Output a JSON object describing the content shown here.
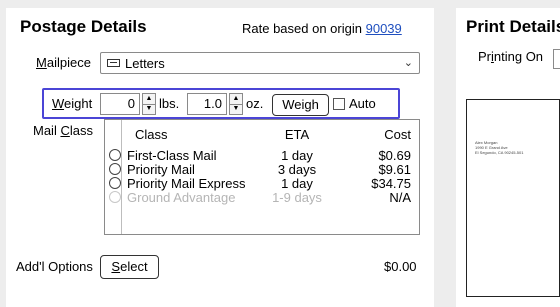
{
  "postage": {
    "title": "Postage Details",
    "rate_text": "Rate based on origin",
    "rate_zip": "90039",
    "mailpiece_label_u": "M",
    "mailpiece_label_rest": "ailpiece",
    "mailpiece_value": "Letters",
    "weight_label_u": "W",
    "weight_label_rest": "eight",
    "lbs_value": "0",
    "lbs_unit": "lbs.",
    "oz_value": "1.0",
    "oz_unit": "oz.",
    "weigh_label": "Weigh",
    "auto_label": "Auto",
    "mail_class_label_pre": "Mail ",
    "mail_class_label_u": "C",
    "mail_class_label_rest": "lass",
    "table_headers": [
      "Class",
      "ETA",
      "Cost"
    ],
    "rows": [
      {
        "class": "First-Class Mail",
        "eta": "1 day",
        "cost": "$0.69"
      },
      {
        "class": "Priority Mail",
        "eta": "3 days",
        "cost": "$9.61"
      },
      {
        "class": "Priority Mail Express",
        "eta": "1 day",
        "cost": "$34.75"
      },
      {
        "class": "Ground Advantage",
        "eta": "1-9 days",
        "cost": "N/A"
      }
    ],
    "addl_label": "Add'l Options",
    "select_u": "S",
    "select_rest": "elect",
    "addl_price": "$0.00"
  },
  "print": {
    "title": "Print Details",
    "printing_on_pre": "Pr",
    "printing_on_u": "i",
    "printing_on_rest": "nting On",
    "address_lines": [
      "Alex Morgan",
      "1990 E Grand Ave",
      "El Segundo, CA 90245-501"
    ]
  },
  "colors": {
    "focus_border": "#4b45d6",
    "link": "#1f4fbf",
    "disabled_text": "#b5b5b5"
  }
}
